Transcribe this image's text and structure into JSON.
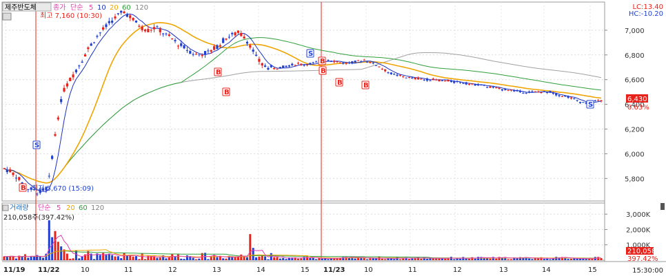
{
  "header": {
    "stock_name": "제주반도체",
    "price_label": "종가",
    "ma_label": "단순",
    "ma_periods": [
      "5",
      "10",
      "20",
      "60",
      "120"
    ],
    "lc_label": "LC:13.40",
    "hc_label": "HC:-10.20"
  },
  "annotations": {
    "high": "최고 7,160 (10:30)",
    "low": "최저 5,670 (15:09)"
  },
  "volume_header": {
    "title": "거래량",
    "ma_label": "단순",
    "ma_periods": [
      "5",
      "20",
      "60",
      "120"
    ],
    "current_value": "210,058주(397.42%)"
  },
  "price_axis": {
    "ticks": [
      "7,000",
      "6,800",
      "6,600",
      "6,400",
      "6,200",
      "6,000",
      "5,800"
    ]
  },
  "volume_axis": {
    "ticks": [
      "3,000K",
      "2,000K",
      "1,000K"
    ]
  },
  "current": {
    "price": "6,430",
    "change": "0.63%",
    "volume": "210,058",
    "volume_pct": "397.42%"
  },
  "time_axis": {
    "labels": [
      "11/19",
      "11/22",
      "10",
      "11",
      "12",
      "13",
      "14",
      "15",
      "11/23",
      "10",
      "11",
      "12",
      "13",
      "14",
      "15"
    ],
    "end_label": "15:30:00"
  },
  "colors": {
    "up": "#e8221b",
    "down": "#1f3fd0",
    "ma5": "#1a2fbf",
    "ma20": "#f0a400",
    "ma60": "#2f9e3a",
    "ma120": "#a0a0a0",
    "vol_ma5": "#e040b0"
  },
  "signals": [
    "S",
    "B"
  ],
  "chart_data": {
    "type": "candlestick",
    "title": "제주반도체",
    "y_range": [
      5640,
      7200
    ],
    "volume_range": [
      0,
      3500000
    ],
    "day_sessions": [
      {
        "date": "11/22",
        "hours": [
          "10",
          "11",
          "12",
          "13",
          "14",
          "15"
        ]
      },
      {
        "date": "11/23",
        "hours": [
          "10",
          "11",
          "12",
          "13",
          "14",
          "15"
        ]
      }
    ],
    "price_path": [
      [
        0,
        5880
      ],
      [
        2,
        5860
      ],
      [
        4,
        5820
      ],
      [
        6,
        5760
      ],
      [
        8,
        5720
      ],
      [
        10,
        5700
      ],
      [
        12,
        5690
      ],
      [
        14,
        5720
      ],
      [
        15,
        5800
      ],
      [
        16,
        5980
      ],
      [
        17,
        6150
      ],
      [
        18,
        6300
      ],
      [
        19,
        6420
      ],
      [
        20,
        6520
      ],
      [
        22,
        6600
      ],
      [
        24,
        6680
      ],
      [
        26,
        6760
      ],
      [
        28,
        6850
      ],
      [
        30,
        6920
      ],
      [
        32,
        6980
      ],
      [
        34,
        7030
      ],
      [
        36,
        7080
      ],
      [
        38,
        7120
      ],
      [
        40,
        7150
      ],
      [
        42,
        7110
      ],
      [
        44,
        7060
      ],
      [
        46,
        7020
      ],
      [
        48,
        7000
      ],
      [
        50,
        7020
      ],
      [
        52,
        7000
      ],
      [
        54,
        6960
      ],
      [
        56,
        6930
      ],
      [
        58,
        6890
      ],
      [
        60,
        6860
      ],
      [
        62,
        6830
      ],
      [
        64,
        6800
      ],
      [
        66,
        6810
      ],
      [
        68,
        6820
      ],
      [
        70,
        6850
      ],
      [
        72,
        6890
      ],
      [
        74,
        6940
      ],
      [
        76,
        6960
      ],
      [
        78,
        6980
      ],
      [
        80,
        6950
      ],
      [
        82,
        6880
      ],
      [
        84,
        6780
      ],
      [
        86,
        6720
      ],
      [
        88,
        6700
      ],
      [
        90,
        6690
      ],
      [
        92,
        6700
      ],
      [
        94,
        6710
      ],
      [
        96,
        6720
      ],
      [
        98,
        6730
      ],
      [
        100,
        6720
      ],
      [
        102,
        6730
      ],
      [
        104,
        6740
      ],
      [
        106,
        6750
      ],
      [
        108,
        6760
      ],
      [
        110,
        6750
      ],
      [
        112,
        6740
      ],
      [
        114,
        6730
      ],
      [
        116,
        6740
      ],
      [
        118,
        6750
      ],
      [
        120,
        6760
      ],
      [
        122,
        6740
      ],
      [
        124,
        6720
      ],
      [
        126,
        6690
      ],
      [
        128,
        6660
      ],
      [
        130,
        6640
      ],
      [
        132,
        6630
      ],
      [
        134,
        6620
      ],
      [
        136,
        6610
      ],
      [
        138,
        6610
      ],
      [
        140,
        6600
      ],
      [
        142,
        6600
      ],
      [
        144,
        6600
      ],
      [
        146,
        6590
      ],
      [
        148,
        6590
      ],
      [
        150,
        6580
      ],
      [
        152,
        6580
      ],
      [
        154,
        6570
      ],
      [
        156,
        6560
      ],
      [
        158,
        6560
      ],
      [
        160,
        6550
      ],
      [
        162,
        6540
      ],
      [
        164,
        6530
      ],
      [
        166,
        6520
      ],
      [
        168,
        6520
      ],
      [
        170,
        6510
      ],
      [
        172,
        6500
      ],
      [
        174,
        6500
      ],
      [
        176,
        6500
      ],
      [
        178,
        6500
      ],
      [
        180,
        6500
      ],
      [
        182,
        6500
      ],
      [
        184,
        6480
      ],
      [
        186,
        6470
      ],
      [
        188,
        6460
      ],
      [
        190,
        6440
      ],
      [
        192,
        6420
      ],
      [
        194,
        6410
      ],
      [
        196,
        6420
      ],
      [
        198,
        6430
      ]
    ],
    "volume_spikes": [
      {
        "i": 15,
        "v": 2600000
      },
      {
        "i": 16,
        "v": 1500000
      },
      {
        "i": 17,
        "v": 1900000
      },
      {
        "i": 18,
        "v": 1200000
      },
      {
        "i": 19,
        "v": 900000
      },
      {
        "i": 20,
        "v": 700000
      },
      {
        "i": 24,
        "v": 650000
      },
      {
        "i": 28,
        "v": 600000
      },
      {
        "i": 82,
        "v": 1700000
      },
      {
        "i": 83,
        "v": 800000
      },
      {
        "i": 198,
        "v": 210058
      }
    ]
  }
}
